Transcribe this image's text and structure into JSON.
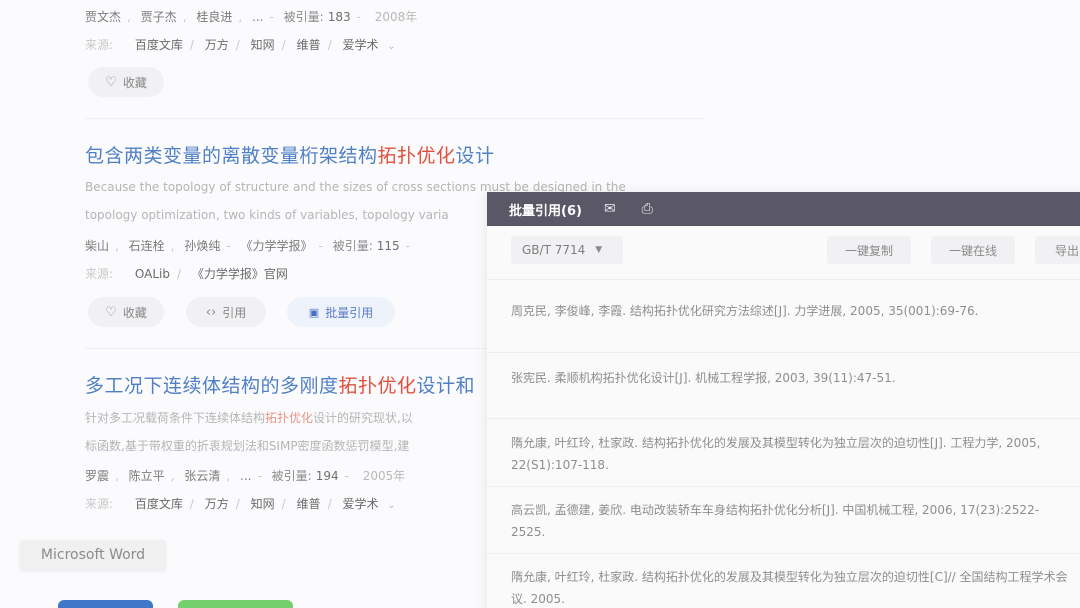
{
  "results": [
    {
      "authors": [
        "贾文杰",
        "贾子杰",
        "桂良进"
      ],
      "authors_more": "...",
      "cite_label": "被引量:",
      "cite_count": "183",
      "year": "2008年",
      "source_label": "来源:",
      "sources": [
        "百度文库",
        "万方",
        "知网",
        "维普",
        "爱学术"
      ],
      "actions": [
        "收藏"
      ]
    },
    {
      "title_parts": [
        {
          "text": "包含两类变量的离散变量桁架结构",
          "hl": false
        },
        {
          "text": "拓扑优化",
          "hl": true
        },
        {
          "text": "设计",
          "hl": false
        }
      ],
      "abstract_lines": [
        "Because the topology of structure and the sizes of cross sections must be designed in the",
        "topology optimization, two kinds of variables, topology varia"
      ],
      "authors": [
        "柴山",
        "石连栓",
        "孙焕纯"
      ],
      "journal": "《力学学报》",
      "cite_label": "被引量:",
      "cite_count": "115",
      "source_label": "来源:",
      "sources": [
        "OALib",
        "《力学学报》官网"
      ],
      "actions": [
        "收藏",
        "引用",
        "批量引用"
      ]
    },
    {
      "title_parts": [
        {
          "text": "多工况下连续体结构的多刚度",
          "hl": false
        },
        {
          "text": "拓扑优化",
          "hl": true
        },
        {
          "text": "设计和",
          "hl": false
        }
      ],
      "abstract_lines": [
        {
          "a": "针对多工况载荷条件下连续体结构",
          "hl": "拓扑优化",
          "b": "设计的研究现状,以"
        },
        {
          "a": "标函数,基于带权重的折衷规划法和SIMP密度函数惩罚模型,建",
          "hl": "",
          "b": ""
        }
      ],
      "authors": [
        "罗震",
        "陈立平",
        "张云清"
      ],
      "authors_more": "...",
      "cite_label": "被引量:",
      "cite_count": "194",
      "year": "2005年",
      "source_label": "来源:",
      "sources": [
        "百度文库",
        "万方",
        "知网",
        "维普",
        "爱学术"
      ]
    }
  ],
  "tooltip": "Microsoft Word",
  "panel": {
    "title": "批量引用(6)",
    "header_icons": [
      "mail-icon",
      "print-icon"
    ],
    "format": "GB/T 7714",
    "buttons": [
      "一键复制",
      "一键在线",
      "导出"
    ],
    "references": [
      "周克民, 李俊峰, 李霞. 结构拓扑优化研究方法综述[J]. 力学进展, 2005, 35(001):69-76.",
      "张宪民. 柔顺机构拓扑优化设计[J]. 机械工程学报, 2003, 39(11):47-51.",
      "隋允康, 叶红玲, 杜家政. 结构拓扑优化的发展及其模型转化为独立层次的迫切性[J]. 工程力学, 2005, 22(S1):107-118.",
      "高云凯, 孟德建, 姜欣. 电动改装轿车车身结构拓扑优化分析[J]. 中国机械工程, 2006, 17(23):2522-2525.",
      "隋允康, 叶红玲, 杜家政. 结构拓扑优化的发展及其模型转化为独立层次的迫切性[C]// 全国结构工程学术会议. 2005."
    ]
  },
  "colors": {
    "title_blue": "#4f7fc4",
    "highlight_red": "#e0513d",
    "panel_header": "#5a5866"
  }
}
